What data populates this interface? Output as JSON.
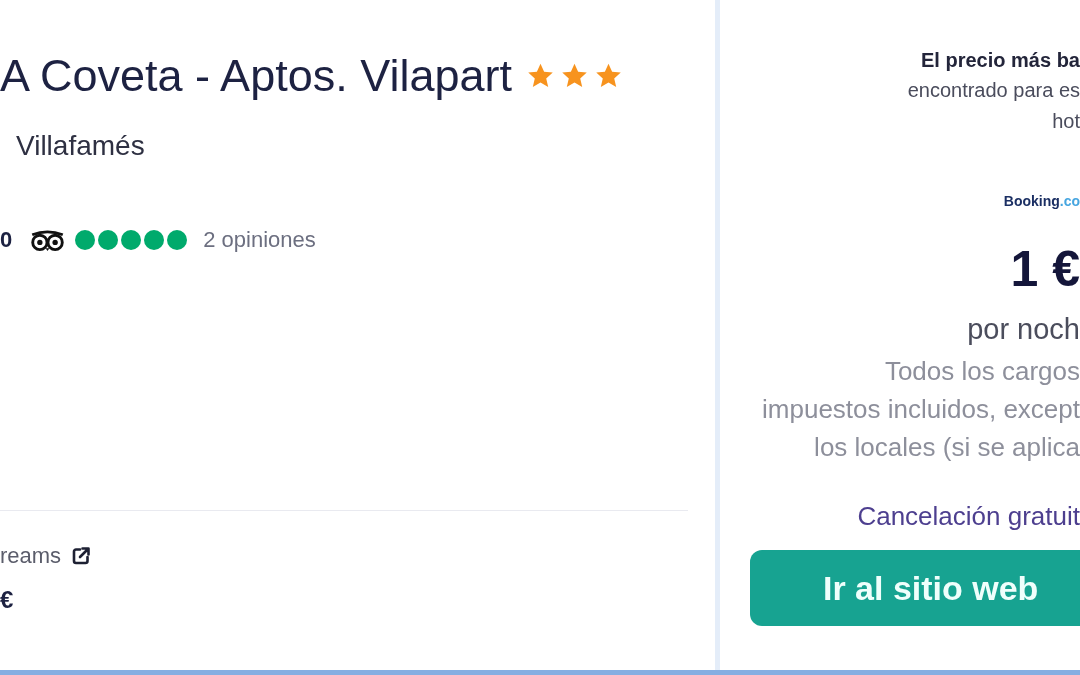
{
  "hotel": {
    "name": "A Coveta - Aptos. Vilapart",
    "stars": 3,
    "location": "Villafamés",
    "rating": {
      "score": "0",
      "stars": 5,
      "reviews": "2 opiniones"
    }
  },
  "deal": {
    "provider": "reams",
    "price": "€"
  },
  "best_price": {
    "title": "El precio más ba",
    "lines": [
      "encontrado para es",
      "hot"
    ],
    "provider": {
      "name": "Booking",
      "domain": ".co"
    },
    "price": "1 €",
    "unit": "por noch",
    "tax_note": [
      "Todos los cargos",
      "impuestos incluidos, except",
      "los locales (si se aplica"
    ],
    "cancellation": "Cancelación gratuit",
    "button": "Ir al sitio web"
  }
}
